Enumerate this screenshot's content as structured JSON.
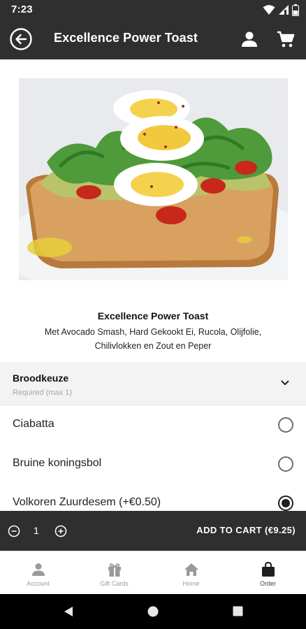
{
  "status_bar": {
    "time": "7:23"
  },
  "app_bar": {
    "title": "Excellence Power Toast"
  },
  "product": {
    "name": "Excellence Power Toast",
    "description": "Met Avocado Smash, Hard Gekookt Ei, Rucola, Olijfolie, Chilivlokken en Zout en Peper"
  },
  "section": {
    "title": "Broodkeuze",
    "subtitle": "Required (max 1)"
  },
  "options": [
    {
      "label": "Ciabatta",
      "selected": false
    },
    {
      "label": "Bruine koningsbol",
      "selected": false
    },
    {
      "label": "Volkoren Zuurdesem (+€0.50)",
      "selected": true
    }
  ],
  "cart_bar": {
    "quantity": "1",
    "add_label": "ADD TO CART (€9.25)"
  },
  "bottom_nav": [
    {
      "label": "Account",
      "icon": "person-icon",
      "active": false
    },
    {
      "label": "Gift Cards",
      "icon": "gift-icon",
      "active": false
    },
    {
      "label": "Home",
      "icon": "home-icon",
      "active": false
    },
    {
      "label": "Order",
      "icon": "shopping-bag-icon",
      "active": true
    }
  ],
  "colors": {
    "bar": "#2f2f2f",
    "section_bg": "#f3f3f3",
    "nav_inactive": "#9a9a9a",
    "radio_selected": "#1f1f1f"
  }
}
